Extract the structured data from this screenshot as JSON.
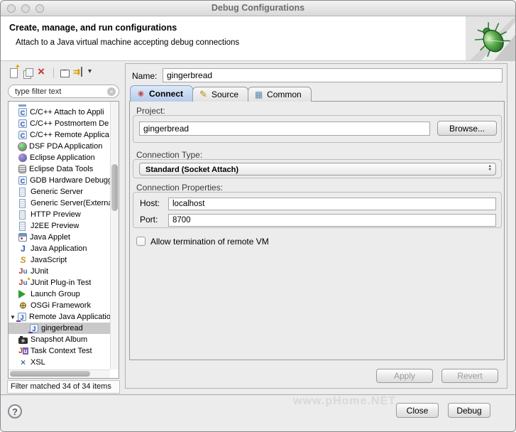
{
  "window": {
    "title": "Debug Configurations"
  },
  "header": {
    "title": "Create, manage, and run configurations",
    "subtitle": "Attach to a Java virtual machine accepting debug connections"
  },
  "sidebar": {
    "toolbar": {
      "items": [
        "new-config",
        "duplicate-config",
        "delete-config",
        "separator",
        "collapse-all",
        "filter-dropdown"
      ]
    },
    "filter": {
      "placeholder": "type filter text"
    },
    "tree": {
      "items": [
        {
          "label": "C/C++ Attach to Appli",
          "icon": "c"
        },
        {
          "label": "C/C++ Postmortem De",
          "icon": "c"
        },
        {
          "label": "C/C++ Remote Applica",
          "icon": "c"
        },
        {
          "label": "DSF PDA Application",
          "icon": "dsf"
        },
        {
          "label": "Eclipse Application",
          "icon": "eclipse"
        },
        {
          "label": "Eclipse Data Tools",
          "icon": "db"
        },
        {
          "label": "GDB Hardware Debugg",
          "icon": "c"
        },
        {
          "label": "Generic Server",
          "icon": "server"
        },
        {
          "label": "Generic Server(Externa",
          "icon": "server"
        },
        {
          "label": "HTTP Preview",
          "icon": "server"
        },
        {
          "label": "J2EE Preview",
          "icon": "server"
        },
        {
          "label": "Java Applet",
          "icon": "applet"
        },
        {
          "label": "Java Application",
          "icon": "java"
        },
        {
          "label": "JavaScript",
          "icon": "js"
        },
        {
          "label": "JUnit",
          "icon": "junit"
        },
        {
          "label": "JUnit Plug-in Test",
          "icon": "junitp"
        },
        {
          "label": "Launch Group",
          "icon": "launch"
        },
        {
          "label": "OSGi Framework",
          "icon": "osgi"
        },
        {
          "label": "Remote Java Applicatio",
          "icon": "remote",
          "expanded": true
        },
        {
          "label": "gingerbread",
          "icon": "remote",
          "indent": true,
          "selected": true
        },
        {
          "label": "Snapshot Album",
          "icon": "camera"
        },
        {
          "label": "Task Context Test",
          "icon": "task"
        },
        {
          "label": "XSL",
          "icon": "xsl"
        }
      ]
    },
    "status": "Filter matched 34 of 34 items"
  },
  "main": {
    "name_label": "Name:",
    "name_value": "gingerbread",
    "tabs": [
      {
        "label": "Connect",
        "icon": "connect",
        "selected": true
      },
      {
        "label": "Source",
        "icon": "source",
        "selected": false
      },
      {
        "label": "Common",
        "icon": "common",
        "selected": false
      }
    ],
    "project": {
      "label": "Project:",
      "value": "gingerbread",
      "browse": "Browse..."
    },
    "connection_type": {
      "label": "Connection Type:",
      "value": "Standard (Socket Attach)"
    },
    "connection_properties": {
      "label": "Connection Properties:",
      "host_label": "Host:",
      "host_value": "localhost",
      "port_label": "Port:",
      "port_value": "8700"
    },
    "allow_termination": {
      "label": "Allow termination of remote VM",
      "checked": false
    },
    "buttons": {
      "apply": "Apply",
      "revert": "Revert"
    }
  },
  "footer": {
    "help": "?",
    "close": "Close",
    "debug": "Debug",
    "watermark": "www.pHome.NET"
  },
  "colors": {
    "tab_selected": "#c3d6ee",
    "selection_gray": "#c9c9c9",
    "delete_red": "#c5342c"
  }
}
